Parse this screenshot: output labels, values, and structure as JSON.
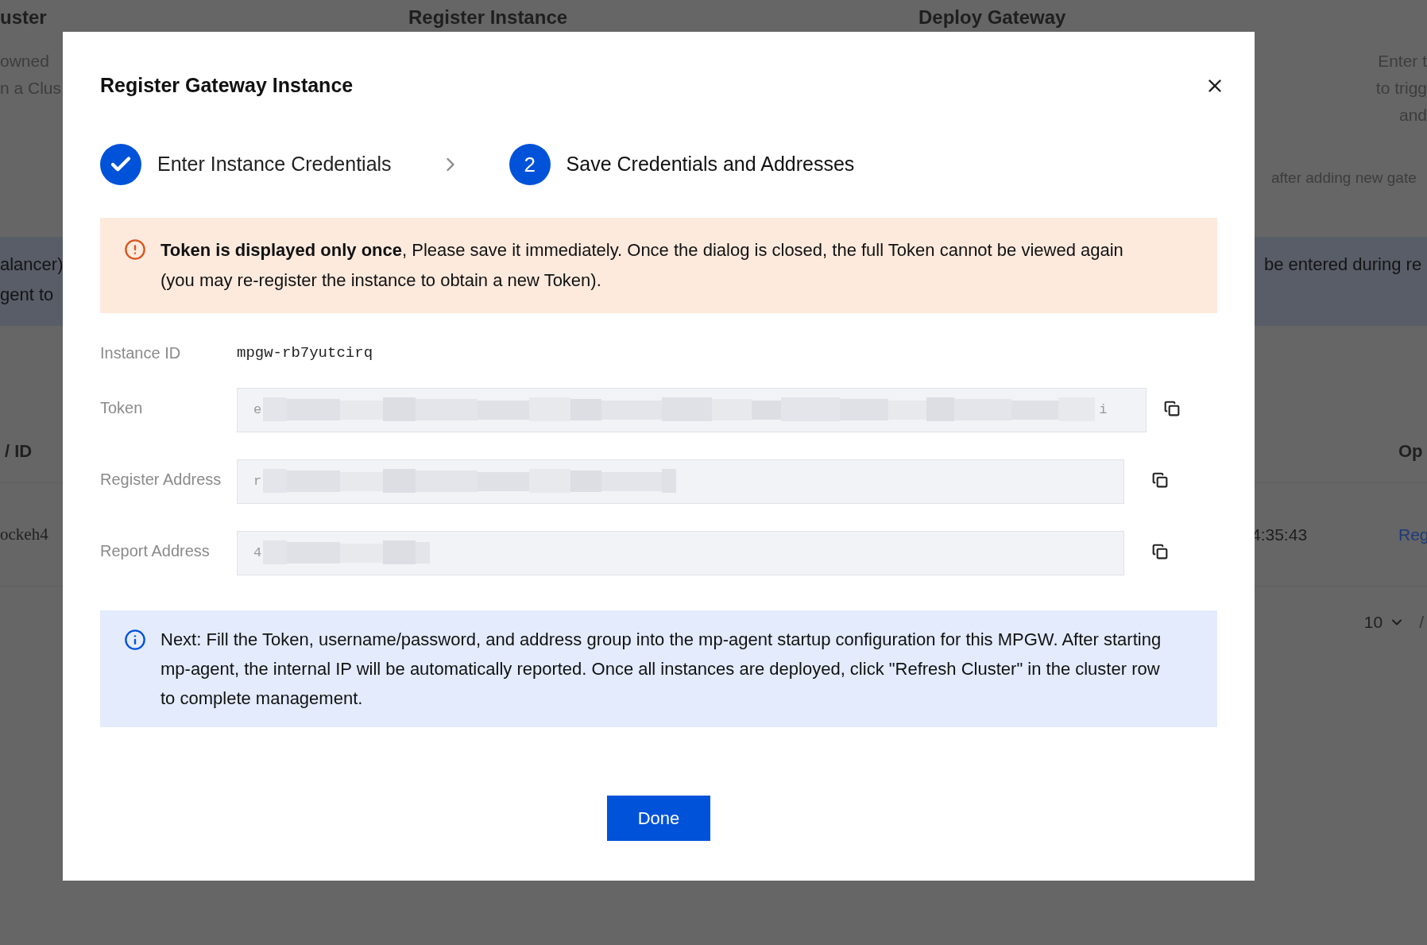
{
  "background": {
    "header": [
      "uster",
      "Register Instance",
      "Deploy Gateway"
    ],
    "intro_left": [
      "owned",
      "n a Clus"
    ],
    "intro_right": [
      "Enter t",
      "to trigg",
      "and"
    ],
    "hint": "after adding new gate",
    "alert_left": [
      "alancer)",
      "gent to"
    ],
    "alert_right": "be entered during re",
    "table": {
      "columns": [
        "/ ID",
        "Op"
      ],
      "rows": [
        {
          "column_1": "ockeh4",
          "column_2": "4:35:43",
          "action": "Reg"
        }
      ]
    },
    "pagination": {
      "page_size": "10",
      "separator": "/"
    }
  },
  "dialog": {
    "title": "Register Gateway Instance",
    "steps": [
      {
        "label": "Enter Instance Credentials",
        "done": true
      },
      {
        "label": "Save Credentials and Addresses",
        "done": false,
        "number": "2"
      }
    ],
    "warning": "**Token is displayed only once**, Please save it immediately. Once the dialog is closed, the full Token cannot be viewed again (you may re-register the instance to obtain a new Token).",
    "fields": [
      {
        "label": "Instance ID",
        "kind": "text",
        "value": "mpgw-rb7yutcirq"
      },
      {
        "label": "Token",
        "kind": "secret",
        "value": "e",
        "value_end": "i"
      },
      {
        "label": "Register Address",
        "kind": "secret",
        "value": "r"
      },
      {
        "label": "Report Address",
        "kind": "secret",
        "value": "4"
      }
    ],
    "info": "Next: Fill the Token, username/password, and address group into the mp-agent startup configuration for this MPGW. After starting mp-agent, the internal IP will be automatically reported. Once all instances are deployed, click \"Refresh Cluster\" in the cluster row to complete management.",
    "done_button": "Done"
  }
}
